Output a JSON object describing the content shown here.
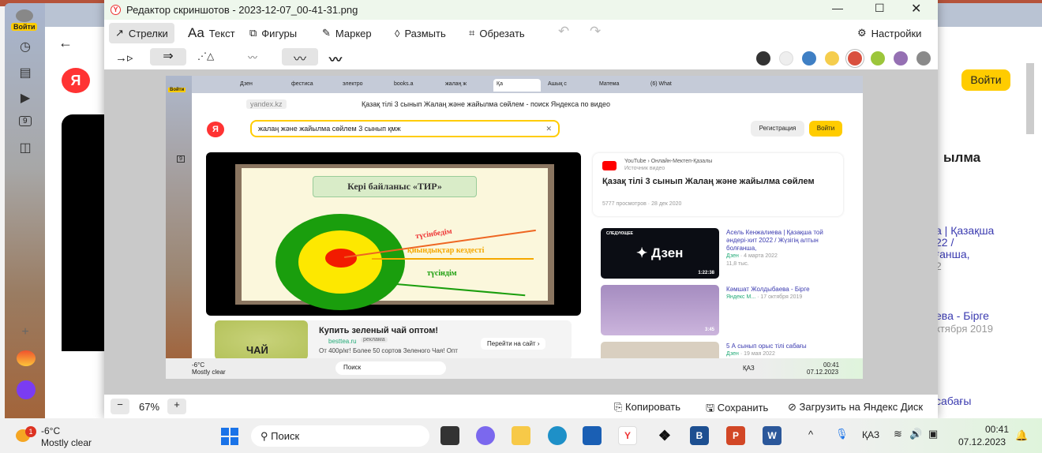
{
  "editor": {
    "title": "Редактор скриншотов - 2023-12-07_00-41-31.png",
    "tools": [
      "Стрелки",
      "Текст",
      "Фигуры",
      "Маркер",
      "Размыть",
      "Обрезать"
    ],
    "text_icon": "Aa",
    "settings": "Настройки",
    "colors": [
      "#333333",
      "#eeeeee",
      "#3f7fc4",
      "#f5cd4d",
      "#d9503f",
      "#9cc63b",
      "#9570b3",
      "#8a8a8a"
    ],
    "zoom": "67%",
    "zoom_minus": "−",
    "zoom_plus": "+",
    "copy": "Копировать",
    "save": "Сохранить",
    "upload": "Загрузить на Яндекс Диск"
  },
  "bg": {
    "login": "Войти",
    "card_title": "ылма",
    "r1": "а | Қазақша",
    "r2": "22 /",
    "r3": "ғанша,",
    "r4": "2",
    "r5": "ева - Бірге",
    "r6": "ктября 2019",
    "r7": "сабағы",
    "profile": "Войти",
    "count": "9"
  },
  "inner": {
    "profile": "Войти",
    "tabs": [
      "Дзен",
      "фестиса",
      "электро",
      "books.a",
      "жалаң ж",
      "Қа",
      "Ашық с",
      "Матема",
      "(6) What"
    ],
    "url": "yandex.kz",
    "page_title": "Қазақ тілі 3 сынып Жалаң және жайылма сөйлем - поиск Яндекса по видео",
    "search_value": "жалаң және жайылма сөйлем 3 сынып қмж",
    "register": "Регистрация",
    "login": "Войти",
    "count": "9",
    "slide": {
      "title": "Кері байланыс «ТИР»",
      "l1": "түсінбедім",
      "l2": "қиындықтар кездесті",
      "l3": "түсіндім"
    },
    "ad": {
      "title": "Купить зеленый чай оптом!",
      "domain": "besttea.ru",
      "badge": "реклама",
      "desc": "От 400р/кг! Более 50 сортов Зеленого Чая! Опт",
      "cta": "Перейти на сайт ›",
      "img_text": "ЧАЙ"
    },
    "video": {
      "source": "YouTube › Онлайн-Мектеп-Қазалы",
      "source_sub": "Источник видео",
      "title": "Қазақ тілі 3 сынып Жалаң және жайылма сөйлем",
      "views": "5777 просмотров",
      "date": "28 дек 2020"
    },
    "related": [
      {
        "title": "Асель Кенжалиева | Қазақша той әндері-хит 2022 / Жүзігің алтын болғанша,",
        "channel": "Дзен",
        "date": "· 4 марта 2022",
        "views": "11,8 тыс.",
        "duration": "1:22:38",
        "label": "СЛЕДУЮЩЕЕ",
        "thumb": "Дзен"
      },
      {
        "title": "Кәмшат Жолдыбаева - Бірге",
        "channel": "Яндекс М...",
        "date": "· 17 октября 2019",
        "duration": "3:45"
      },
      {
        "title": "5 А сынып орыс тілі сабағы",
        "channel": "Дзен",
        "date": "· 19 мая 2022"
      }
    ],
    "taskbar": {
      "temp": "-6°C",
      "weather": "Mostly clear",
      "search": "Поиск",
      "lang": "ҚАЗ",
      "time": "00:41",
      "date": "07.12.2023"
    }
  },
  "taskbar": {
    "badge": "1",
    "temp": "-6°C",
    "weather": "Mostly clear",
    "search": "Поиск",
    "lang": "ҚАЗ",
    "time": "00:41",
    "date": "07.12.2023"
  }
}
